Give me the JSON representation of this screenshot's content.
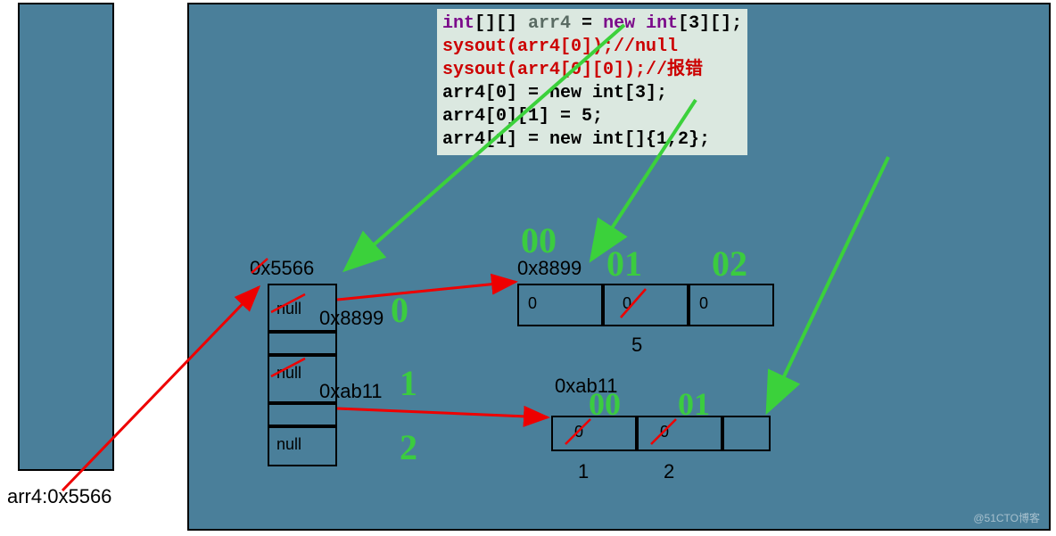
{
  "stack": {
    "label": "arr4:0x5566"
  },
  "addr": {
    "arr": "0x5566",
    "sub0": "0x8899",
    "sub1": "0xab11"
  },
  "arrCells": [
    {
      "crossed": "null",
      "newVal": "0x8899"
    },
    {
      "crossed": "null",
      "newVal": "0xab11"
    },
    {
      "crossed": "null",
      "newVal": ""
    }
  ],
  "sub0": {
    "cells": [
      "0",
      "0",
      "0"
    ],
    "below": [
      "",
      "5",
      ""
    ],
    "handIdx": [
      "00",
      "01",
      "02"
    ]
  },
  "sub1": {
    "cells": [
      "0",
      "0"
    ],
    "below": [
      "1",
      "2"
    ],
    "handIdx": [
      "00",
      "01"
    ]
  },
  "handArr": [
    "0",
    "1",
    "2"
  ],
  "code": {
    "l1_int": "int",
    "l1_brackets": "[][]",
    "l1_arr": " arr4 ",
    "l1_eq": "= ",
    "l1_new": "new int",
    "l1_rest": "[3][];",
    "l2": "sysout(arr4[0]);//null",
    "l3": "sysout(arr4[0][0]);//报错",
    "l4": "arr4[0] = new int[3];",
    "l5": "arr4[0][1] = 5;",
    "l6": "arr4[1] = new int[]{1,2};"
  },
  "watermark": "@51CTO博客"
}
